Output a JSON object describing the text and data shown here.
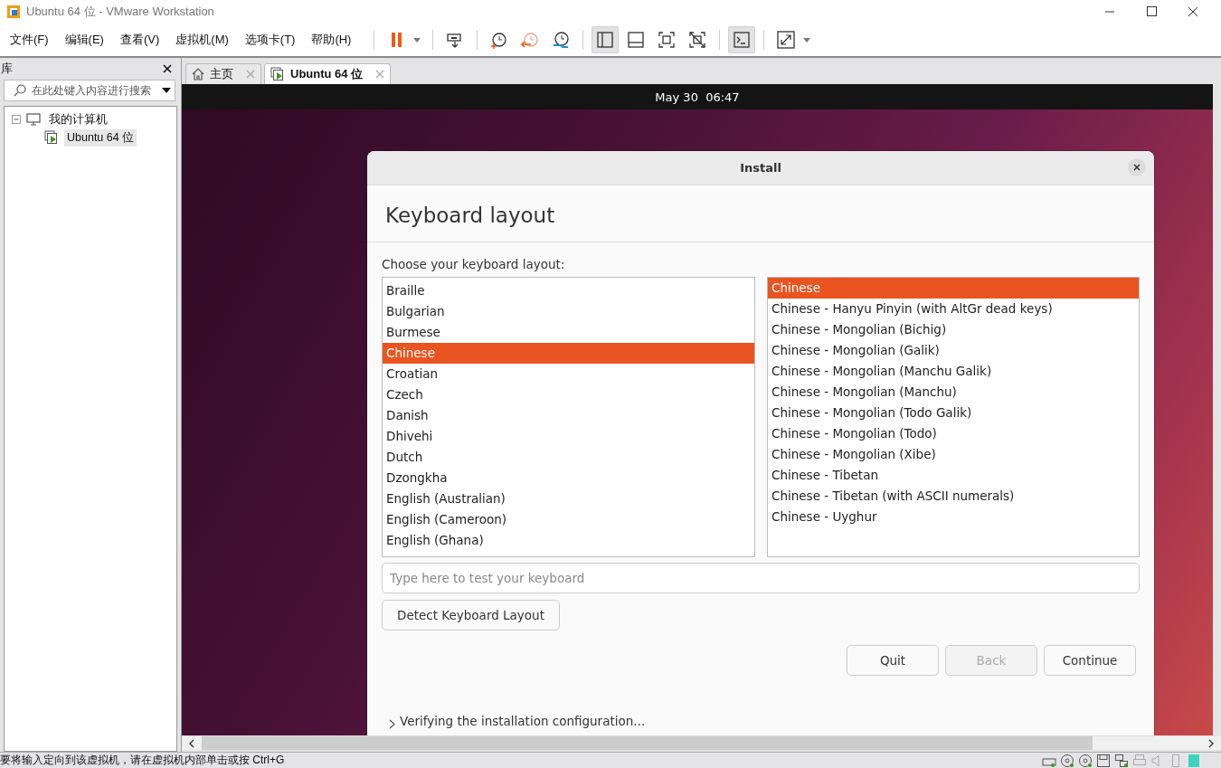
{
  "window": {
    "title": "Ubuntu 64 位 - VMware Workstation"
  },
  "menu": [
    "文件(F)",
    "编辑(E)",
    "查看(V)",
    "虚拟机(M)",
    "选项卡(T)",
    "帮助(H)"
  ],
  "toolbar": [
    [
      {
        "kind": "pause",
        "pressed": false
      }
    ],
    [
      {
        "kind": "send-keys",
        "pressed": false
      }
    ],
    [
      {
        "kind": "snapshot",
        "pressed": false
      },
      {
        "kind": "revert",
        "pressed": false
      },
      {
        "kind": "snapshot-manager",
        "pressed": false
      }
    ],
    [
      {
        "kind": "sidebar-view",
        "pressed": true
      },
      {
        "kind": "thumbnail-bar",
        "pressed": false
      },
      {
        "kind": "fullscreen",
        "pressed": false
      },
      {
        "kind": "unity",
        "pressed": false
      }
    ],
    [
      {
        "kind": "console",
        "pressed": true
      }
    ],
    [
      {
        "kind": "stretch",
        "pressed": false
      }
    ]
  ],
  "library": {
    "title": "库",
    "search": {
      "placeholder": "在此处键入内容进行搜索"
    },
    "tree": [
      {
        "label": "我的计算机",
        "expanded": true,
        "children": [
          {
            "label": "Ubuntu 64 位",
            "selected": true
          }
        ]
      }
    ]
  },
  "tabs": [
    {
      "label": "主页",
      "kind": "home",
      "selected": false
    },
    {
      "label": "Ubuntu 64 位",
      "kind": "vm",
      "selected": true
    }
  ],
  "guest": {
    "clock": "May 30  06:47",
    "dialog": {
      "title": "Install",
      "heading": "Keyboard layout",
      "prompt": "Choose your keyboard layout:",
      "layouts": [
        {
          "label": "Braille",
          "selected": false
        },
        {
          "label": "Bulgarian",
          "selected": false
        },
        {
          "label": "Burmese",
          "selected": false
        },
        {
          "label": "Chinese",
          "selected": true
        },
        {
          "label": "Croatian",
          "selected": false
        },
        {
          "label": "Czech",
          "selected": false
        },
        {
          "label": "Danish",
          "selected": false
        },
        {
          "label": "Dhivehi",
          "selected": false
        },
        {
          "label": "Dutch",
          "selected": false
        },
        {
          "label": "Dzongkha",
          "selected": false
        },
        {
          "label": "English (Australian)",
          "selected": false
        },
        {
          "label": "English (Cameroon)",
          "selected": false
        },
        {
          "label": "English (Ghana)",
          "selected": false
        }
      ],
      "variants": [
        {
          "label": "Chinese",
          "selected": true
        },
        {
          "label": "Chinese - Hanyu Pinyin (with AltGr dead keys)",
          "selected": false
        },
        {
          "label": "Chinese - Mongolian (Bichig)",
          "selected": false
        },
        {
          "label": "Chinese - Mongolian (Galik)",
          "selected": false
        },
        {
          "label": "Chinese - Mongolian (Manchu Galik)",
          "selected": false
        },
        {
          "label": "Chinese - Mongolian (Manchu)",
          "selected": false
        },
        {
          "label": "Chinese - Mongolian (Todo Galik)",
          "selected": false
        },
        {
          "label": "Chinese - Mongolian (Todo)",
          "selected": false
        },
        {
          "label": "Chinese - Mongolian (Xibe)",
          "selected": false
        },
        {
          "label": "Chinese - Tibetan",
          "selected": false
        },
        {
          "label": "Chinese - Tibetan (with ASCII numerals)",
          "selected": false
        },
        {
          "label": "Chinese - Uyghur",
          "selected": false
        }
      ],
      "test_field": {
        "placeholder": "Type here to test your keyboard"
      },
      "detect_button": "Detect Keyboard Layout",
      "buttons": [
        {
          "label": "Quit",
          "disabled": false
        },
        {
          "label": "Back",
          "disabled": true
        },
        {
          "label": "Continue",
          "disabled": false
        }
      ],
      "progress_note": "Verifying the installation configuration..."
    }
  },
  "status_bar": {
    "text": "要将输入定向到该虚拟机，请在虚拟机内部单击或按 Ctrl+G"
  }
}
